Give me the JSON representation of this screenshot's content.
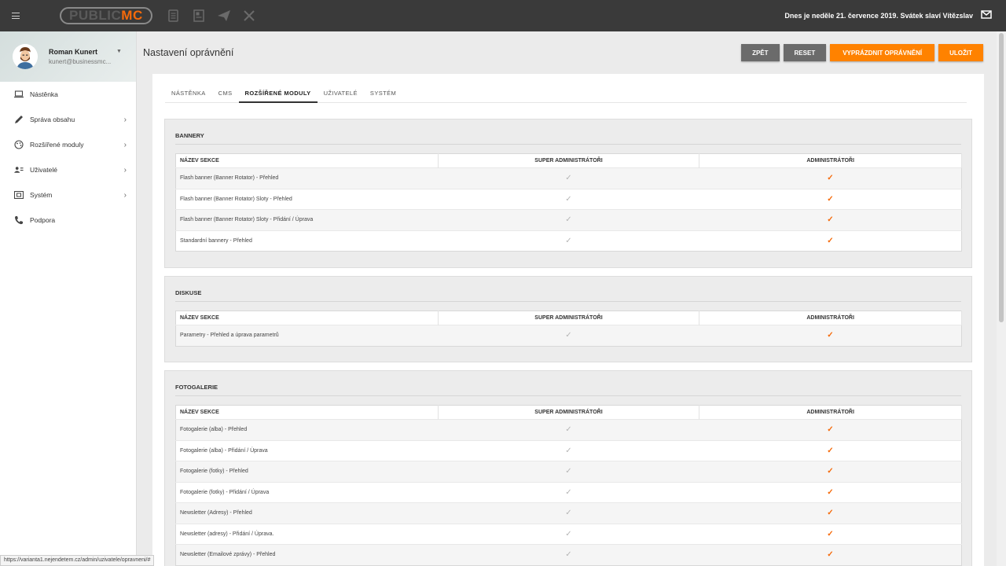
{
  "topbar": {
    "logo_part1": "PUBLIC",
    "logo_part2": "MC",
    "date_text": "Dnes je neděle 21. července 2019. Svátek slaví Vítězslav",
    "icons": [
      "menu-icon",
      "document-icon",
      "page-icon",
      "send-icon",
      "tools-icon",
      "mail-icon"
    ]
  },
  "user": {
    "name": "Roman Kunert",
    "email": "kunert@businessmc..."
  },
  "sidebar": {
    "items": [
      {
        "label": "Nástěnka",
        "icon": "laptop-icon",
        "has_children": false
      },
      {
        "label": "Správa obsahu",
        "icon": "pencil-icon",
        "has_children": true
      },
      {
        "label": "Rozšířené moduly",
        "icon": "palette-icon",
        "has_children": true
      },
      {
        "label": "Uživatelé",
        "icon": "users-icon",
        "has_children": true
      },
      {
        "label": "Systém",
        "icon": "system-icon",
        "has_children": true
      },
      {
        "label": "Podpora",
        "icon": "phone-icon",
        "has_children": false
      }
    ]
  },
  "header": {
    "title": "Nastavení oprávnění",
    "buttons": {
      "back": "ZPĚT",
      "reset": "RESET",
      "clear": "VYPRÁZDNIT OPRÁVNĚNÍ",
      "save": "ULOŽIT"
    }
  },
  "tabs": [
    "NÁSTĚNKA",
    "CMS",
    "ROZŠÍŘENÉ MODULY",
    "UŽIVATELÉ",
    "SYSTÉM"
  ],
  "active_tab": "ROZŠÍŘENÉ MODULY",
  "columns": [
    "NÁZEV SEKCE",
    "SUPER ADMINISTRÁTOŘI",
    "ADMINISTRÁTOŘI"
  ],
  "check_glyph": "✓",
  "colors": {
    "accent": "#ff8200",
    "check_admin": "#f56a0a",
    "check_super": "#b5b5b5",
    "topbar": "#3a3a3a"
  },
  "sections": [
    {
      "title": "BANNERY",
      "rows": [
        "Flash banner (Banner Rotator) - Přehled",
        "Flash banner (Banner Rotator) Sloty - Přehled",
        "Flash banner (Banner Rotator) Sloty - Přidání / Úprava",
        "Standardní bannery - Přehled"
      ]
    },
    {
      "title": "DISKUSE",
      "rows": [
        "Parametry - Přehled a úprava parametrů"
      ]
    },
    {
      "title": "FOTOGALERIE",
      "rows": [
        "Fotogalerie (alba) - Přehled",
        "Fotogalerie (alba) - Přidání / Úprava",
        "Fotogalerie (fotky) - Přehled",
        "Fotogalerie (fotky) - Přidání / Úprava",
        "Newsletter (Adresy) - Přehled",
        "Newsletter (adresy) - Přidání / Úprava.",
        "Newsletter (Emailové zprávy) - Přehled"
      ]
    }
  ],
  "status_url": "https://varianta1.nejendetem.cz/admin/uzivatele/opravneni/#"
}
